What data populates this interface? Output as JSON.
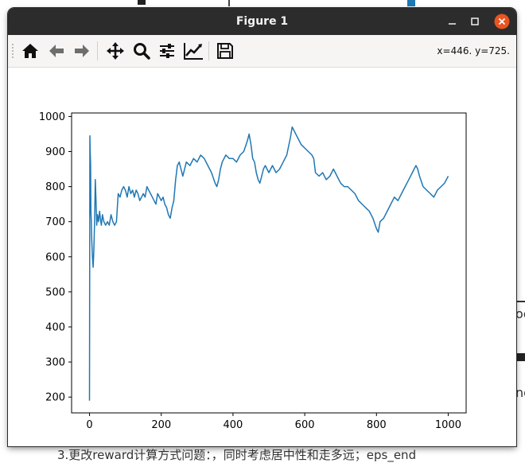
{
  "window": {
    "title": "Figure 1",
    "buttons": [
      "minimize-icon",
      "maximize-icon",
      "close-icon"
    ],
    "close_color": "#e95420"
  },
  "toolbar": {
    "buttons": [
      {
        "name": "home-button",
        "icon": "home-icon"
      },
      {
        "name": "back-button",
        "icon": "arrow-left-icon"
      },
      {
        "name": "forward-button",
        "icon": "arrow-right-icon"
      },
      {
        "name": "pan-button",
        "icon": "move-icon"
      },
      {
        "name": "zoom-button",
        "icon": "magnifier-icon"
      },
      {
        "name": "subplots-button",
        "icon": "sliders-icon"
      },
      {
        "name": "customize-button",
        "icon": "line-chart-icon"
      },
      {
        "name": "save-button",
        "icon": "floppy-disk-icon"
      }
    ],
    "coordinates": "x=446. y=725."
  },
  "background": {
    "right_text_1": "oc",
    "right_text_2": "nd",
    "bottom_text": "3.更改reward计算方式问题：，同时考虑居中性和走多远；eps_end"
  },
  "chart_data": {
    "type": "line",
    "title": "",
    "xlabel": "",
    "ylabel": "",
    "xlim": [
      -50,
      1050
    ],
    "ylim": [
      155,
      1010
    ],
    "xticks": [
      0,
      200,
      400,
      600,
      800,
      1000
    ],
    "yticks": [
      200,
      300,
      400,
      500,
      600,
      700,
      800,
      900,
      1000
    ],
    "grid": false,
    "color": "#1f77b4",
    "series": [
      {
        "x": [
          0,
          1,
          2,
          3,
          4,
          5,
          6,
          8,
          10,
          12,
          14,
          16,
          18,
          20,
          22,
          25,
          28,
          30,
          33,
          36,
          40,
          45,
          50,
          55,
          60,
          65,
          70,
          75,
          80,
          85,
          90,
          95,
          100,
          105,
          110,
          115,
          120,
          125,
          130,
          135,
          140,
          145,
          150,
          155,
          160,
          165,
          170,
          175,
          180,
          185,
          190,
          195,
          200,
          205,
          210,
          215,
          220,
          225,
          230,
          235,
          240,
          245,
          250,
          255,
          260,
          270,
          280,
          290,
          300,
          310,
          320,
          330,
          340,
          350,
          355,
          360,
          365,
          370,
          380,
          390,
          400,
          410,
          420,
          430,
          440,
          445,
          450,
          455,
          460,
          465,
          470,
          475,
          480,
          485,
          490,
          500,
          510,
          520,
          530,
          540,
          550,
          560,
          565,
          570,
          575,
          580,
          590,
          600,
          610,
          620,
          625,
          630,
          640,
          650,
          660,
          670,
          680,
          690,
          700,
          710,
          720,
          730,
          740,
          750,
          760,
          770,
          780,
          790,
          800,
          805,
          810,
          820,
          830,
          840,
          850,
          860,
          870,
          880,
          890,
          900,
          905,
          910,
          915,
          920,
          930,
          940,
          950,
          960,
          970,
          980,
          990,
          1000
        ],
        "y": [
          190,
          945,
          900,
          860,
          730,
          700,
          650,
          600,
          570,
          620,
          700,
          820,
          760,
          690,
          720,
          700,
          730,
          710,
          690,
          720,
          700,
          690,
          700,
          690,
          720,
          700,
          690,
          700,
          780,
          770,
          790,
          800,
          790,
          770,
          800,
          780,
          790,
          770,
          790,
          780,
          760,
          770,
          780,
          770,
          800,
          790,
          780,
          770,
          760,
          750,
          780,
          770,
          760,
          770,
          750,
          740,
          720,
          710,
          740,
          760,
          820,
          860,
          870,
          850,
          830,
          870,
          860,
          880,
          870,
          890,
          880,
          860,
          840,
          810,
          800,
          820,
          850,
          870,
          890,
          880,
          880,
          870,
          890,
          900,
          930,
          950,
          920,
          880,
          870,
          840,
          820,
          810,
          830,
          850,
          860,
          840,
          860,
          840,
          850,
          870,
          890,
          940,
          970,
          960,
          950,
          940,
          920,
          910,
          900,
          890,
          880,
          840,
          830,
          840,
          820,
          830,
          850,
          830,
          810,
          800,
          800,
          790,
          780,
          760,
          750,
          740,
          730,
          710,
          680,
          670,
          700,
          710,
          730,
          750,
          770,
          760,
          780,
          800,
          820,
          840,
          850,
          860,
          850,
          830,
          800,
          790,
          780,
          770,
          790,
          800,
          810,
          830
        ]
      }
    ]
  }
}
